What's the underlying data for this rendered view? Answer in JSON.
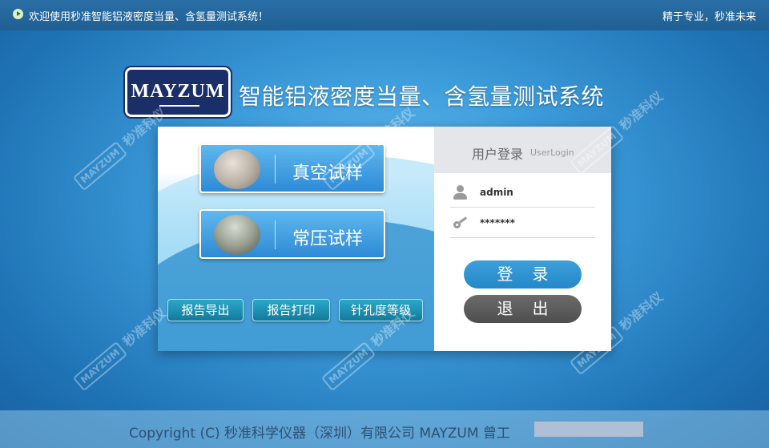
{
  "topbar": {
    "welcome": "欢迎使用秒准智能铝液密度当量、含氢量测试系统！",
    "slogan": "精于专业，秒准未来"
  },
  "header": {
    "logo_text": "MAYZUM",
    "title": "智能铝液密度当量、含氢量测试系统"
  },
  "samples": {
    "vacuum_label": "真空试样",
    "atmospheric_label": "常压试样"
  },
  "actions": {
    "report_export": "报告导出",
    "report_print": "报告打印",
    "pinhole_grade": "针孔度等级"
  },
  "login": {
    "title": "用户登录",
    "subtitle": "UserLogin",
    "username": "admin",
    "password": "*******",
    "login_label": "登录",
    "exit_label": "退出"
  },
  "footer": {
    "copyright": "Copyright (C) 秒准科学仪器（深圳）有限公司 MAYZUM 曾工"
  },
  "watermark": {
    "logo": "MAYZUM",
    "text": "秒准科仪"
  }
}
